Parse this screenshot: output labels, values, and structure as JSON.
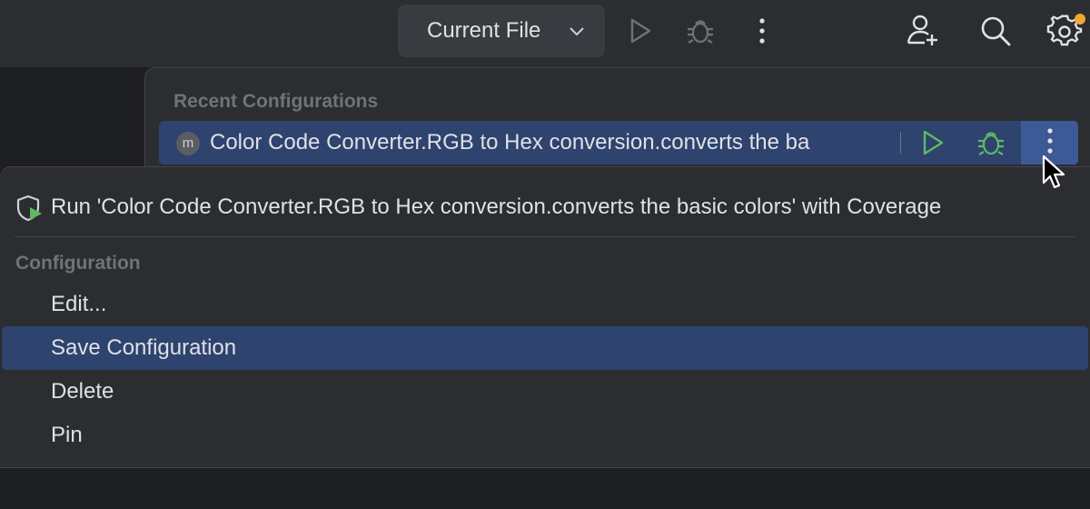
{
  "toolbar": {
    "run_config_label": "Current File",
    "icons": {
      "dropdown": "chevron-down-icon",
      "run": "run-icon",
      "debug": "debug-icon",
      "more": "more-vertical-icon",
      "add_user": "add-user-icon",
      "search": "search-icon",
      "settings": "gear-icon"
    },
    "settings_badge_color": "#f0a732"
  },
  "recent_popup": {
    "header": "Recent Configurations",
    "items": [
      {
        "badge": "m",
        "label": "Color Code Converter.RGB to Hex conversion.converts the ba"
      }
    ]
  },
  "context_menu": {
    "coverage_label": "Run 'Color Code Converter.RGB to Hex conversion.converts the basic colors' with Coverage",
    "section_header": "Configuration",
    "items": [
      {
        "label": "Edit..."
      },
      {
        "label": "Save Configuration"
      },
      {
        "label": "Delete"
      },
      {
        "label": "Pin"
      }
    ]
  },
  "colors": {
    "selection": "#2e436e",
    "run_green": "#5fb865",
    "background": "#2b2d30"
  }
}
